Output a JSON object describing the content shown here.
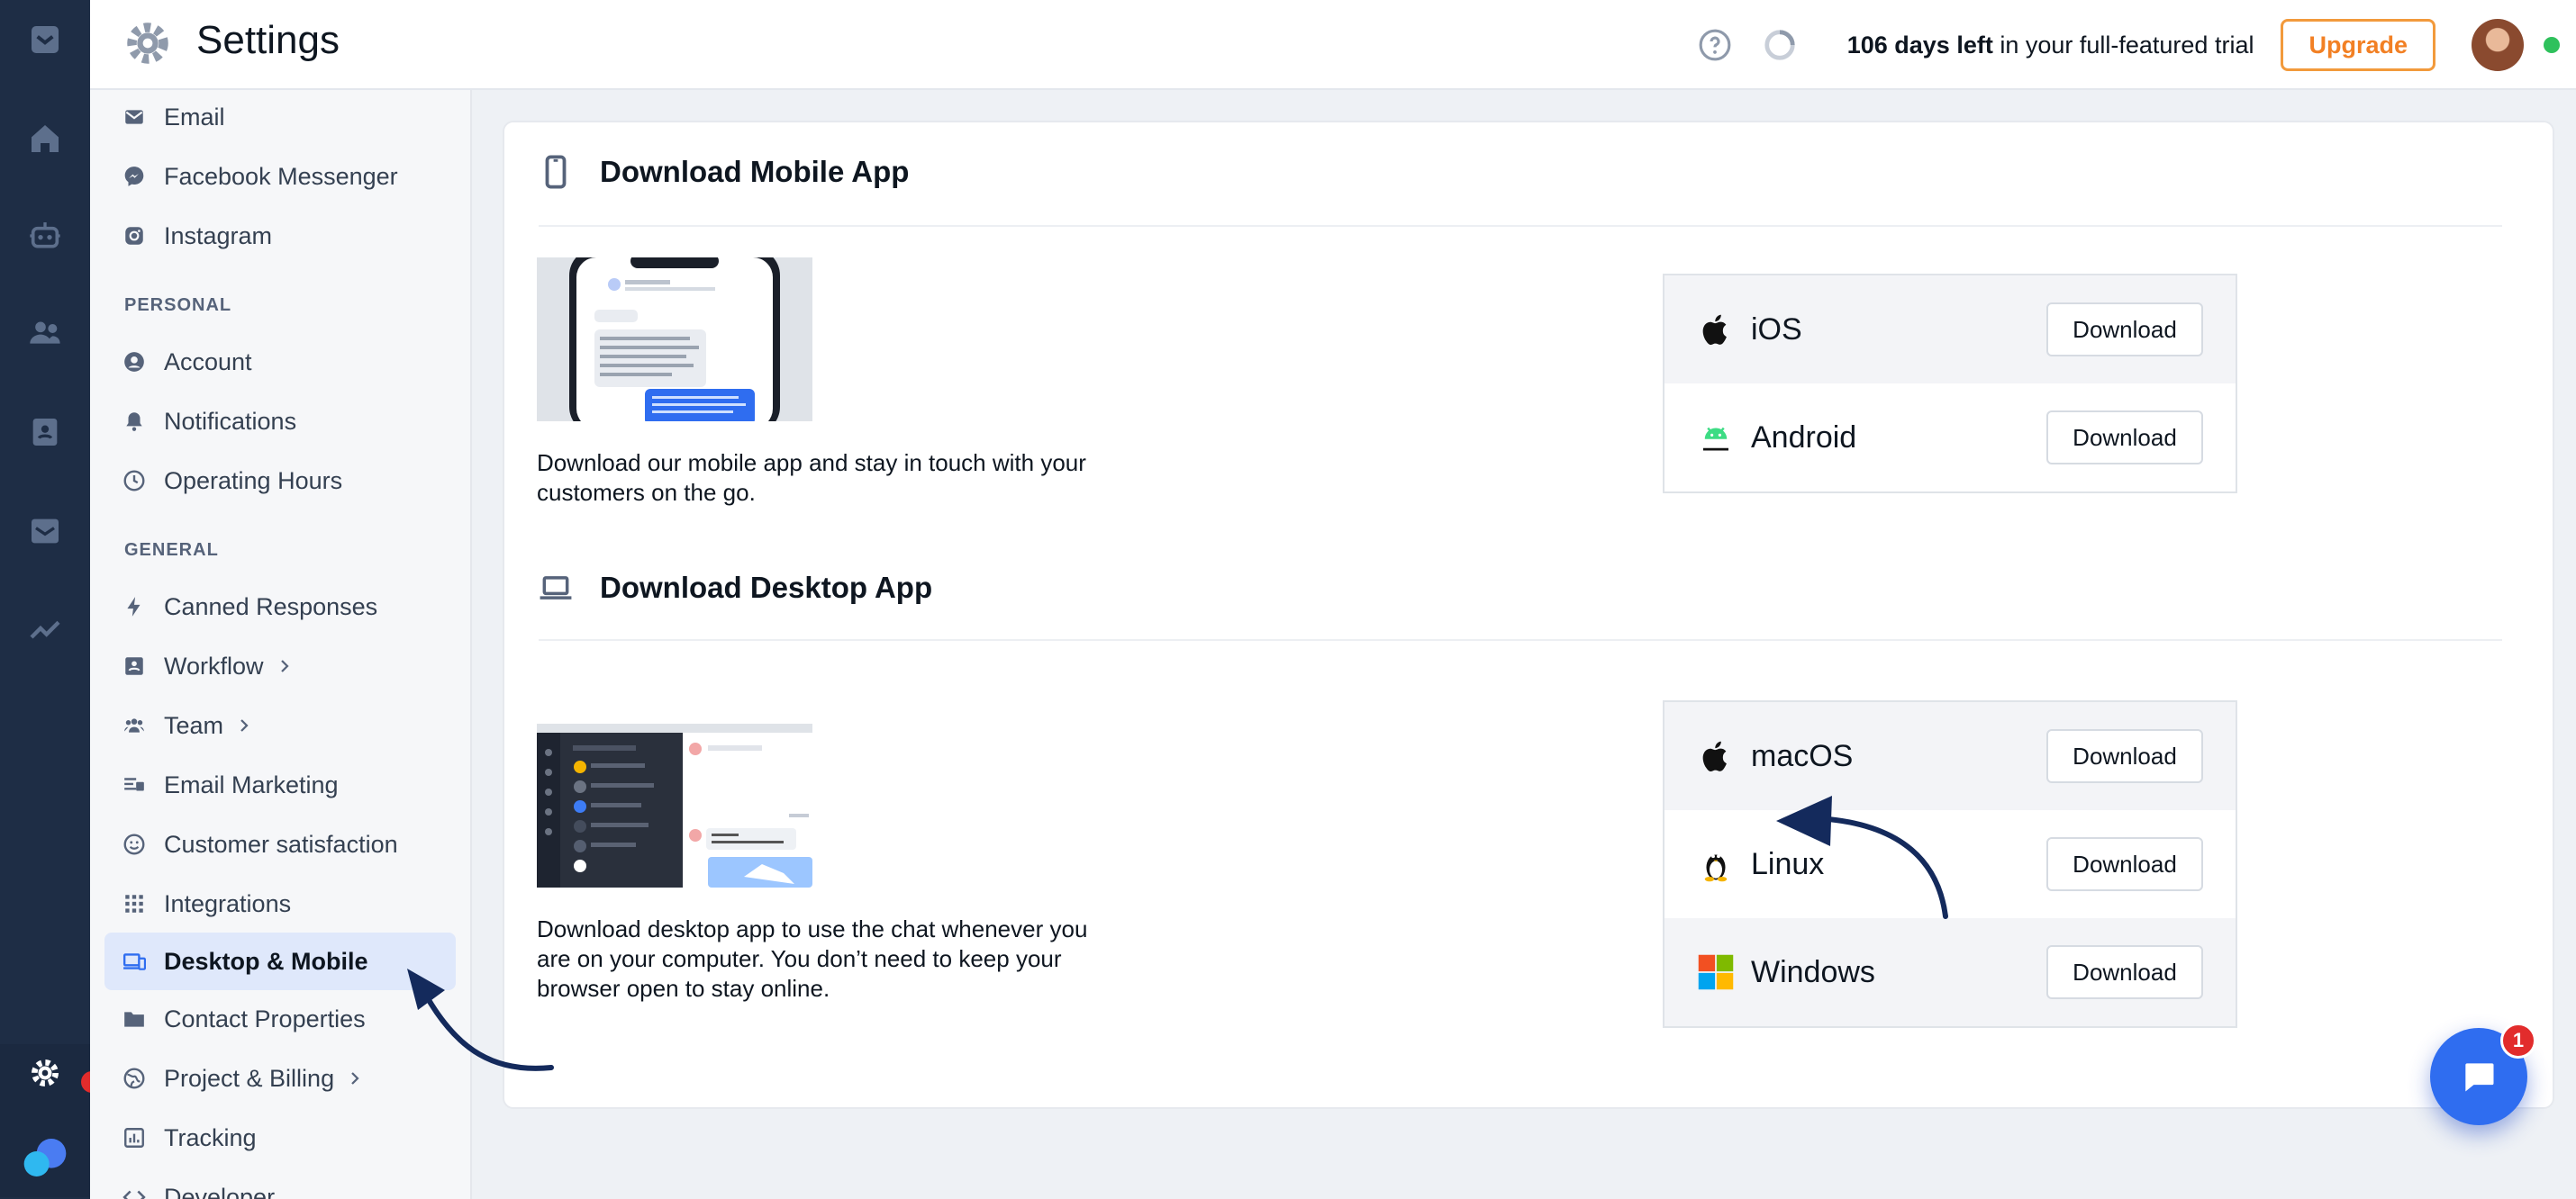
{
  "app": {
    "title": "Settings"
  },
  "topbar": {
    "trial_bold": "106 days left",
    "trial_rest": " in your full-featured trial",
    "upgrade_label": "Upgrade"
  },
  "sidebar": {
    "items_top": [
      {
        "label": "Email",
        "icon": "envelope-icon"
      },
      {
        "label": "Facebook Messenger",
        "icon": "messenger-icon"
      },
      {
        "label": "Instagram",
        "icon": "instagram-icon"
      }
    ],
    "personal_header": "PERSONAL",
    "personal": [
      {
        "label": "Account",
        "icon": "user-circle-icon"
      },
      {
        "label": "Notifications",
        "icon": "bell-icon"
      },
      {
        "label": "Operating Hours",
        "icon": "clock-icon"
      }
    ],
    "general_header": "GENERAL",
    "general": [
      {
        "label": "Canned Responses",
        "icon": "bolt-icon"
      },
      {
        "label": "Workflow",
        "icon": "workflow-icon"
      },
      {
        "label": "Team",
        "icon": "team-icon"
      },
      {
        "label": "Email Marketing",
        "icon": "email-marketing-icon"
      },
      {
        "label": "Customer satisfaction",
        "icon": "smile-icon"
      },
      {
        "label": "Integrations",
        "icon": "grid-icon"
      },
      {
        "label": "Desktop & Mobile",
        "icon": "devices-icon"
      },
      {
        "label": "Contact Properties",
        "icon": "folder-icon"
      },
      {
        "label": "Project & Billing",
        "icon": "globe-icon"
      },
      {
        "label": "Tracking",
        "icon": "chart-icon"
      },
      {
        "label": "Developer",
        "icon": "code-icon"
      }
    ]
  },
  "mobile": {
    "title": "Download Mobile App",
    "description": "Download our mobile app and stay in touch with your customers on the go.",
    "platforms": [
      {
        "name": "iOS",
        "button": "Download",
        "icon": "apple-icon"
      },
      {
        "name": "Android",
        "button": "Download",
        "icon": "android-icon"
      }
    ]
  },
  "desktop": {
    "title": "Download Desktop App",
    "description": "Download desktop app to use the chat whenever you are on your computer. You don’t need to keep your browser open to stay online.",
    "platforms": [
      {
        "name": "macOS",
        "button": "Download",
        "icon": "apple-icon"
      },
      {
        "name": "Linux",
        "button": "Download",
        "icon": "linux-icon"
      },
      {
        "name": "Windows",
        "button": "Download",
        "icon": "windows-icon"
      }
    ]
  },
  "chat": {
    "badge": "1"
  },
  "colors": {
    "rail": "#1e2d45",
    "accent": "#2f6df0",
    "upgrade": "#f28024",
    "active_bg": "#dfe8fb",
    "arrow": "#142a5c"
  }
}
